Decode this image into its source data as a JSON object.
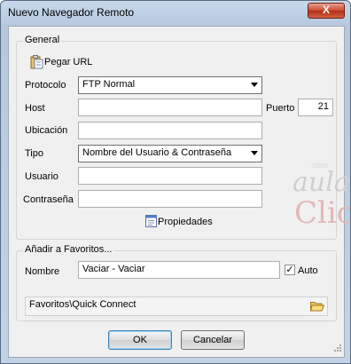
{
  "window": {
    "title": "Nuevo Navegador Remoto",
    "close_label": "X"
  },
  "general": {
    "group_title": "General",
    "paste_url_label": "Pegar URL",
    "protocol_label": "Protocolo",
    "protocol_value": "FTP Normal",
    "host_label": "Host",
    "host_value": "",
    "port_label": "Puerto",
    "port_value": "21",
    "location_label": "Ubicación",
    "location_value": "",
    "type_label": "Tipo",
    "type_value": "Nombre del Usuario & Contraseña",
    "user_label": "Usuario",
    "user_value": "",
    "password_label": "Contraseña",
    "password_value": "",
    "properties_label": "Propiedades"
  },
  "favorites": {
    "group_title": "Añadir a Favoritos...",
    "name_label": "Nombre",
    "name_value": "Vaciar - Vaciar",
    "auto_label": "Auto",
    "auto_checked": true,
    "path_value": "Favoritos\\Quick Connect"
  },
  "buttons": {
    "ok_label": "OK",
    "cancel_label": "Cancelar"
  },
  "watermark": {
    "line1": "aula",
    "line2": "Clic",
    "suffix": ".com"
  }
}
